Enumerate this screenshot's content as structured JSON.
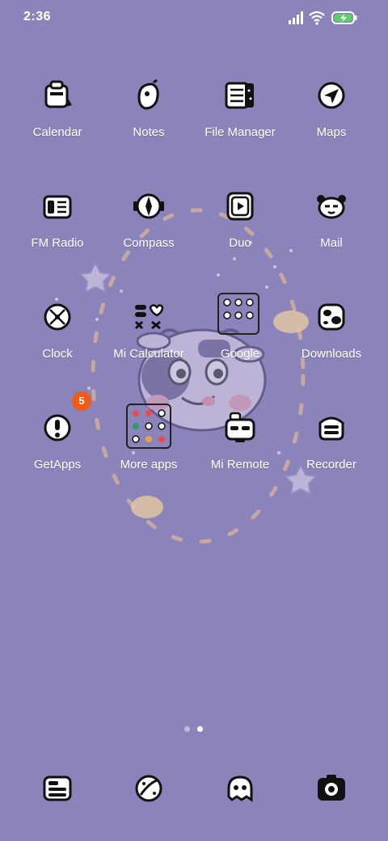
{
  "status_bar": {
    "time": "2:36",
    "battery_color": "#58d16b"
  },
  "colors": {
    "background": "#8a84bb",
    "badge": "#f45a16"
  },
  "home": {
    "row1": [
      {
        "label": "Calendar",
        "icon": "calendar-icon"
      },
      {
        "label": "Notes",
        "icon": "notes-icon"
      },
      {
        "label": "File Manager",
        "icon": "file-manager-icon"
      },
      {
        "label": "Maps",
        "icon": "maps-icon"
      }
    ],
    "row2": [
      {
        "label": "FM Radio",
        "icon": "radio-icon"
      },
      {
        "label": "Compass",
        "icon": "compass-icon"
      },
      {
        "label": "Duo",
        "icon": "duo-icon"
      },
      {
        "label": "Mail",
        "icon": "mail-icon"
      }
    ],
    "row3": [
      {
        "label": "Clock",
        "icon": "clock-icon"
      },
      {
        "label": "Mi Calculator",
        "icon": "calculator-icon"
      },
      {
        "label": "Google",
        "icon": "google-folder-icon"
      },
      {
        "label": "Downloads",
        "icon": "downloads-icon"
      }
    ],
    "row4": [
      {
        "label": "GetApps",
        "icon": "getapps-icon",
        "badge": "5"
      },
      {
        "label": "More apps",
        "icon": "more-apps-folder-icon"
      },
      {
        "label": "Mi Remote",
        "icon": "remote-icon"
      },
      {
        "label": "Recorder",
        "icon": "recorder-icon"
      }
    ]
  },
  "page_indicator": {
    "pages": 2,
    "current": 2
  },
  "dock": [
    {
      "icon": "phone-icon"
    },
    {
      "icon": "messages-icon"
    },
    {
      "icon": "browser-icon"
    },
    {
      "icon": "camera-icon"
    }
  ]
}
